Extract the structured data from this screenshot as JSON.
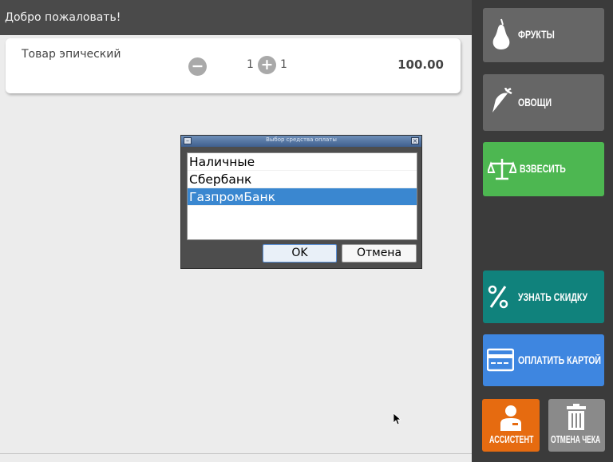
{
  "header": {
    "title": "Добро пожаловать!"
  },
  "cart": {
    "items": [
      {
        "name": "Товар эпический",
        "minus": "−",
        "qty_left": "1",
        "plus": "+",
        "qty_right": "1",
        "price": "100.00"
      }
    ]
  },
  "dialog": {
    "title": "Выбор средства оплаты",
    "options": [
      "Наличные",
      "Сбербанк",
      "ГазпромБанк"
    ],
    "selected": "ГазпромБанк",
    "ok_label": "OK",
    "cancel_label": "Отмена"
  },
  "sidebar": {
    "fruits": {
      "label": "ФРУКТЫ",
      "icon": "pear-icon",
      "color": "#666666"
    },
    "vegetables": {
      "label": "ОВОЩИ",
      "icon": "carrot-icon",
      "color": "#666666"
    },
    "weigh": {
      "label": "ВЗВЕСИТЬ",
      "icon": "scales-icon",
      "color": "#4db751"
    },
    "discount": {
      "label": "УЗНАТЬ СКИДКУ",
      "icon": "percent-icon",
      "color": "#10827c"
    },
    "pay_card": {
      "label": "ОПЛАТИТЬ КАРТОЙ",
      "icon": "credit-card-icon",
      "color": "#3e86e0"
    },
    "assistant": {
      "label": "АССИСТЕНТ",
      "icon": "person-icon",
      "color": "#e66b10"
    },
    "cancel_check": {
      "label": "ОТМЕНА ЧЕКА",
      "icon": "trash-icon",
      "color": "#8a8a8a"
    }
  }
}
